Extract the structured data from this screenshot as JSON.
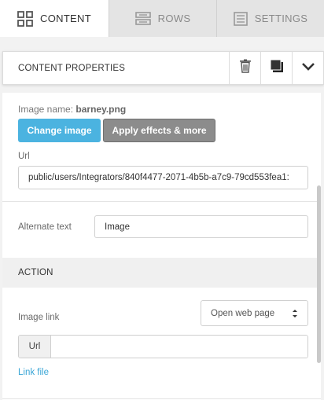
{
  "tabs": [
    {
      "label": "CONTENT",
      "icon": "grid-icon",
      "active": true
    },
    {
      "label": "ROWS",
      "icon": "rows-icon",
      "active": false
    },
    {
      "label": "SETTINGS",
      "icon": "settings-list-icon",
      "active": false
    }
  ],
  "props_bar": {
    "title": "CONTENT PROPERTIES",
    "actions": [
      "trash-icon",
      "duplicate-icon",
      "chevron-down-icon"
    ]
  },
  "image": {
    "name_label": "Image name:",
    "name_value": "barney.png",
    "change_button": "Change image",
    "effects_button": "Apply effects & more",
    "url_label": "Url",
    "url_value": "public/users/Integrators/840f4477-2071-4b5b-a7c9-79cd553fea1:"
  },
  "alt_text": {
    "label": "Alternate text",
    "value": "Image"
  },
  "action": {
    "header": "ACTION",
    "link_label": "Image link",
    "select_value": "Open web page",
    "url_addon": "Url",
    "url_value": "",
    "link_file": "Link file"
  },
  "colors": {
    "accent_blue": "#4bb3e0",
    "grey_button": "#8c8c8c",
    "link": "#3aa6d6"
  }
}
